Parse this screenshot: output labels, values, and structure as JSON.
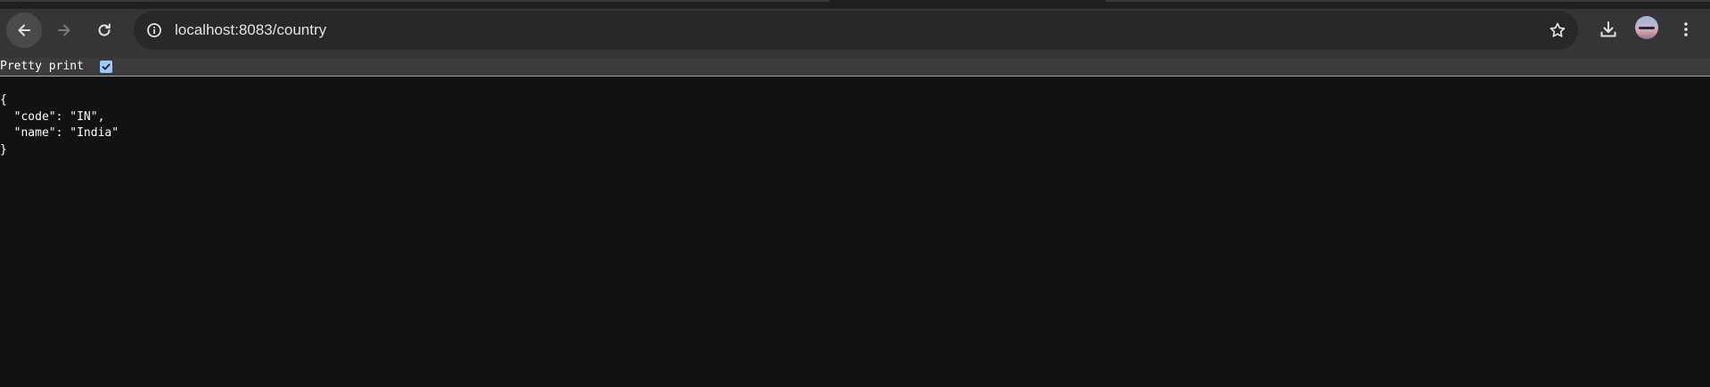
{
  "browser": {
    "url": "localhost:8083/country",
    "icons": {
      "back": "arrow-left-icon",
      "forward": "arrow-right-icon",
      "reload": "reload-icon",
      "site_info": "info-icon",
      "bookmark": "star-icon",
      "downloads": "download-icon",
      "profile": "avatar",
      "menu": "kebab-menu-icon"
    }
  },
  "json_viewer": {
    "pretty_print_label": "Pretty print",
    "pretty_print_checked": true,
    "content": "{\n  \"code\": \"IN\",\n  \"name\": \"India\"\n}"
  },
  "colors": {
    "page_background": "#121212",
    "toolbar": "#353535",
    "omnibox": "#282828",
    "checkbox_accent": "#99c8ff"
  }
}
